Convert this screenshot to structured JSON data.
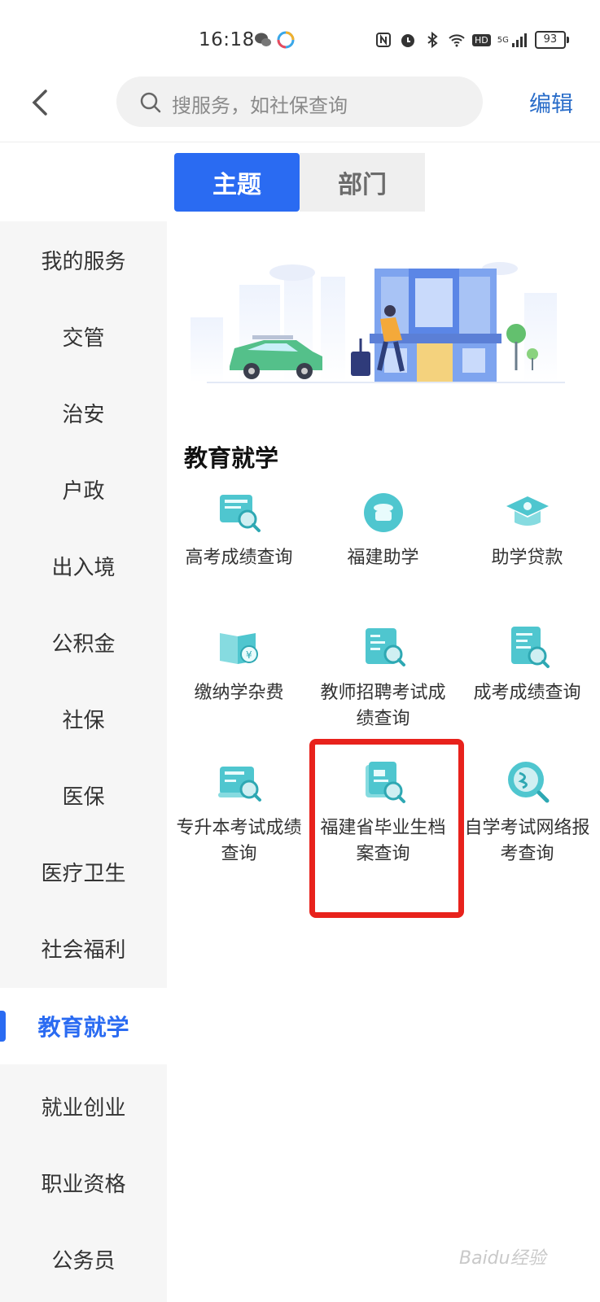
{
  "status_bar": {
    "time": "16:18",
    "battery": "93",
    "network": "5G",
    "hd": "HD"
  },
  "header": {
    "search_placeholder": "搜服务，如社保查询",
    "edit_label": "编辑"
  },
  "tabs": [
    {
      "label": "主题",
      "active": true
    },
    {
      "label": "部门",
      "active": false
    }
  ],
  "sidebar": {
    "items": [
      {
        "label": "我的服务"
      },
      {
        "label": "交管"
      },
      {
        "label": "治安"
      },
      {
        "label": "户政"
      },
      {
        "label": "出入境"
      },
      {
        "label": "公积金"
      },
      {
        "label": "社保"
      },
      {
        "label": "医保"
      },
      {
        "label": "医疗卫生"
      },
      {
        "label": "社会福利"
      },
      {
        "label": "教育就学",
        "active": true
      },
      {
        "label": "就业创业"
      },
      {
        "label": "职业资格"
      },
      {
        "label": "公务员"
      }
    ]
  },
  "section": {
    "title": "教育就学",
    "services": [
      {
        "label": "高考成绩查询",
        "icon": "exam-score-icon"
      },
      {
        "label": "福建助学",
        "icon": "student-aid-icon"
      },
      {
        "label": "助学贷款",
        "icon": "graduation-cap-icon"
      },
      {
        "label": "缴纳学杂费",
        "icon": "book-yuan-icon"
      },
      {
        "label": "教师招聘考试成绩查询",
        "icon": "teacher-exam-icon"
      },
      {
        "label": "成考成绩查询",
        "icon": "adult-exam-icon"
      },
      {
        "label": "专升本考试成绩查询",
        "icon": "upgrade-exam-icon"
      },
      {
        "label": "福建省毕业生档案查询",
        "icon": "archive-search-icon",
        "highlighted": true
      },
      {
        "label": "自学考试网络报考查询",
        "icon": "self-study-icon"
      }
    ]
  },
  "watermark": "Baidu经验",
  "colors": {
    "accent": "#2a6bf2",
    "highlight": "#e8221c",
    "icon_teal": "#4fc6cf"
  }
}
